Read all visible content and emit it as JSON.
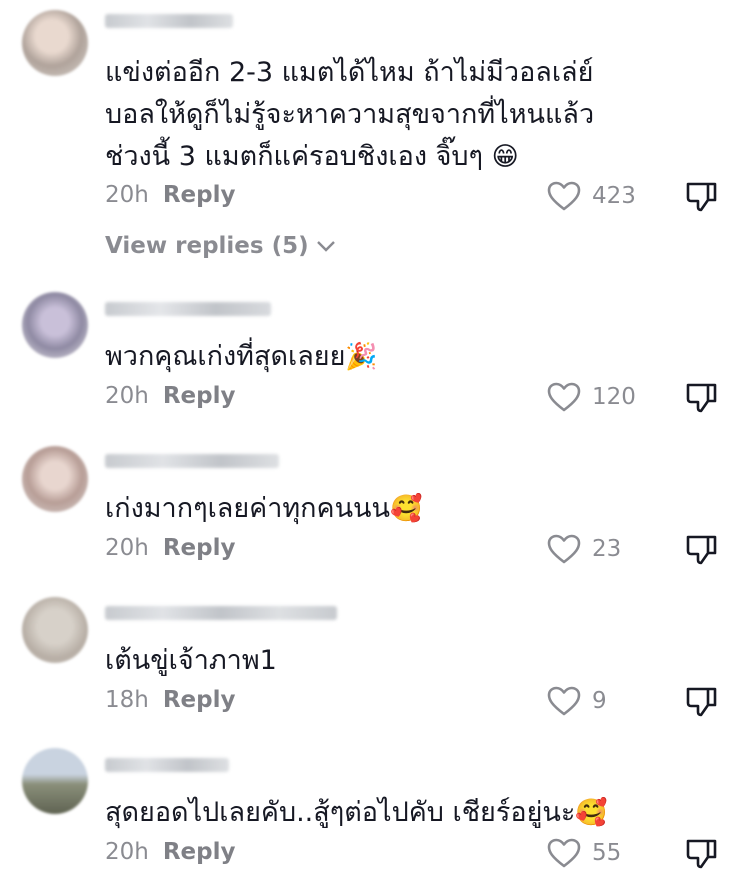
{
  "comments": [
    {
      "text": "แข่งต่ออีก 2-3 แมตได้ไหม ถ้าไม่มีวอลเล่ย์\nบอลให้ดูก็ไม่รู้จะหาความสุขจากที่ไหนแล้ว\nช่วงนี้ 3 แมตก็แค่รอบชิงเอง จิ๊บๆ",
      "emoji": "😁",
      "time": "20h",
      "reply": "Reply",
      "likes": "423"
    },
    {
      "text": "พวกคุณเก่งที่สุดเลยย",
      "emoji": "🎉",
      "time": "20h",
      "reply": "Reply",
      "likes": "120"
    },
    {
      "text": "เก่งมากๆเลยค่าทุกคนนน",
      "emoji": "🥰",
      "time": "20h",
      "reply": "Reply",
      "likes": "23"
    },
    {
      "text": "เต้นขู่เจ้าภาพ1",
      "emoji": "",
      "time": "18h",
      "reply": "Reply",
      "likes": "9"
    },
    {
      "text": "สุดยอดไปเลยคับ..สู้ๆต่อไปคับ เชียร์อยู่นะ",
      "emoji": "🥰",
      "time": "20h",
      "reply": "Reply",
      "likes": "55"
    }
  ],
  "view_replies": "View replies (5)",
  "icons": {
    "like": "heart-outline-icon",
    "dislike": "thumbs-down-icon",
    "chevron": "chevron-down-icon"
  },
  "colors": {
    "text": "#161823",
    "secondary": "#8a8b91"
  }
}
